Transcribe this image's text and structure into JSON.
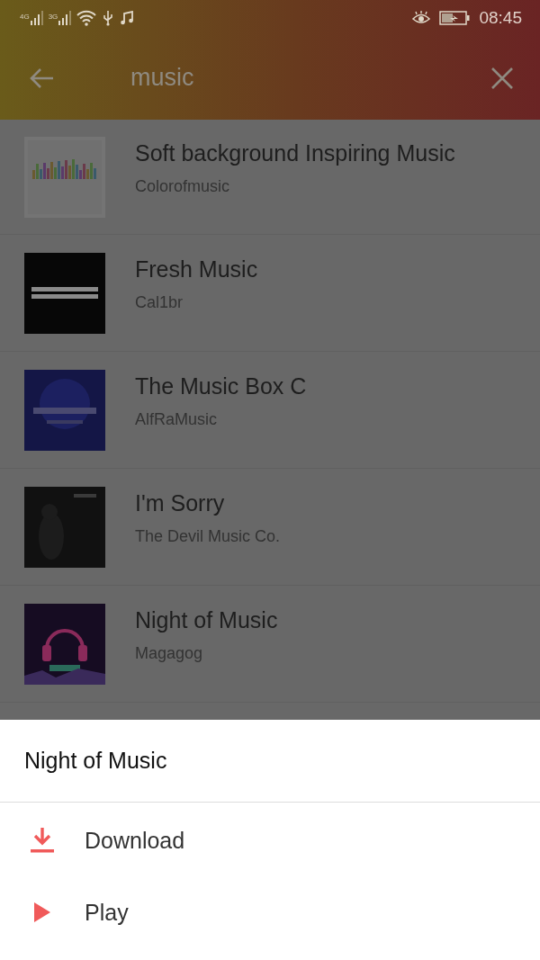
{
  "status_bar": {
    "networks": [
      "4G",
      "3G"
    ],
    "time": "08:45"
  },
  "search": {
    "value": "music"
  },
  "results": [
    {
      "title": "Soft background Inspiring Music",
      "artist": "Colorofmusic"
    },
    {
      "title": "Fresh Music",
      "artist": "Cal1br"
    },
    {
      "title": "The Music Box C",
      "artist": "AlfRaMusic"
    },
    {
      "title": "I'm Sorry",
      "artist": "The Devil Music Co."
    },
    {
      "title": "Night of Music",
      "artist": "Magagog"
    }
  ],
  "sheet": {
    "title": "Night of Music",
    "actions": [
      {
        "kind": "download",
        "label": "Download"
      },
      {
        "kind": "play",
        "label": "Play"
      }
    ]
  }
}
